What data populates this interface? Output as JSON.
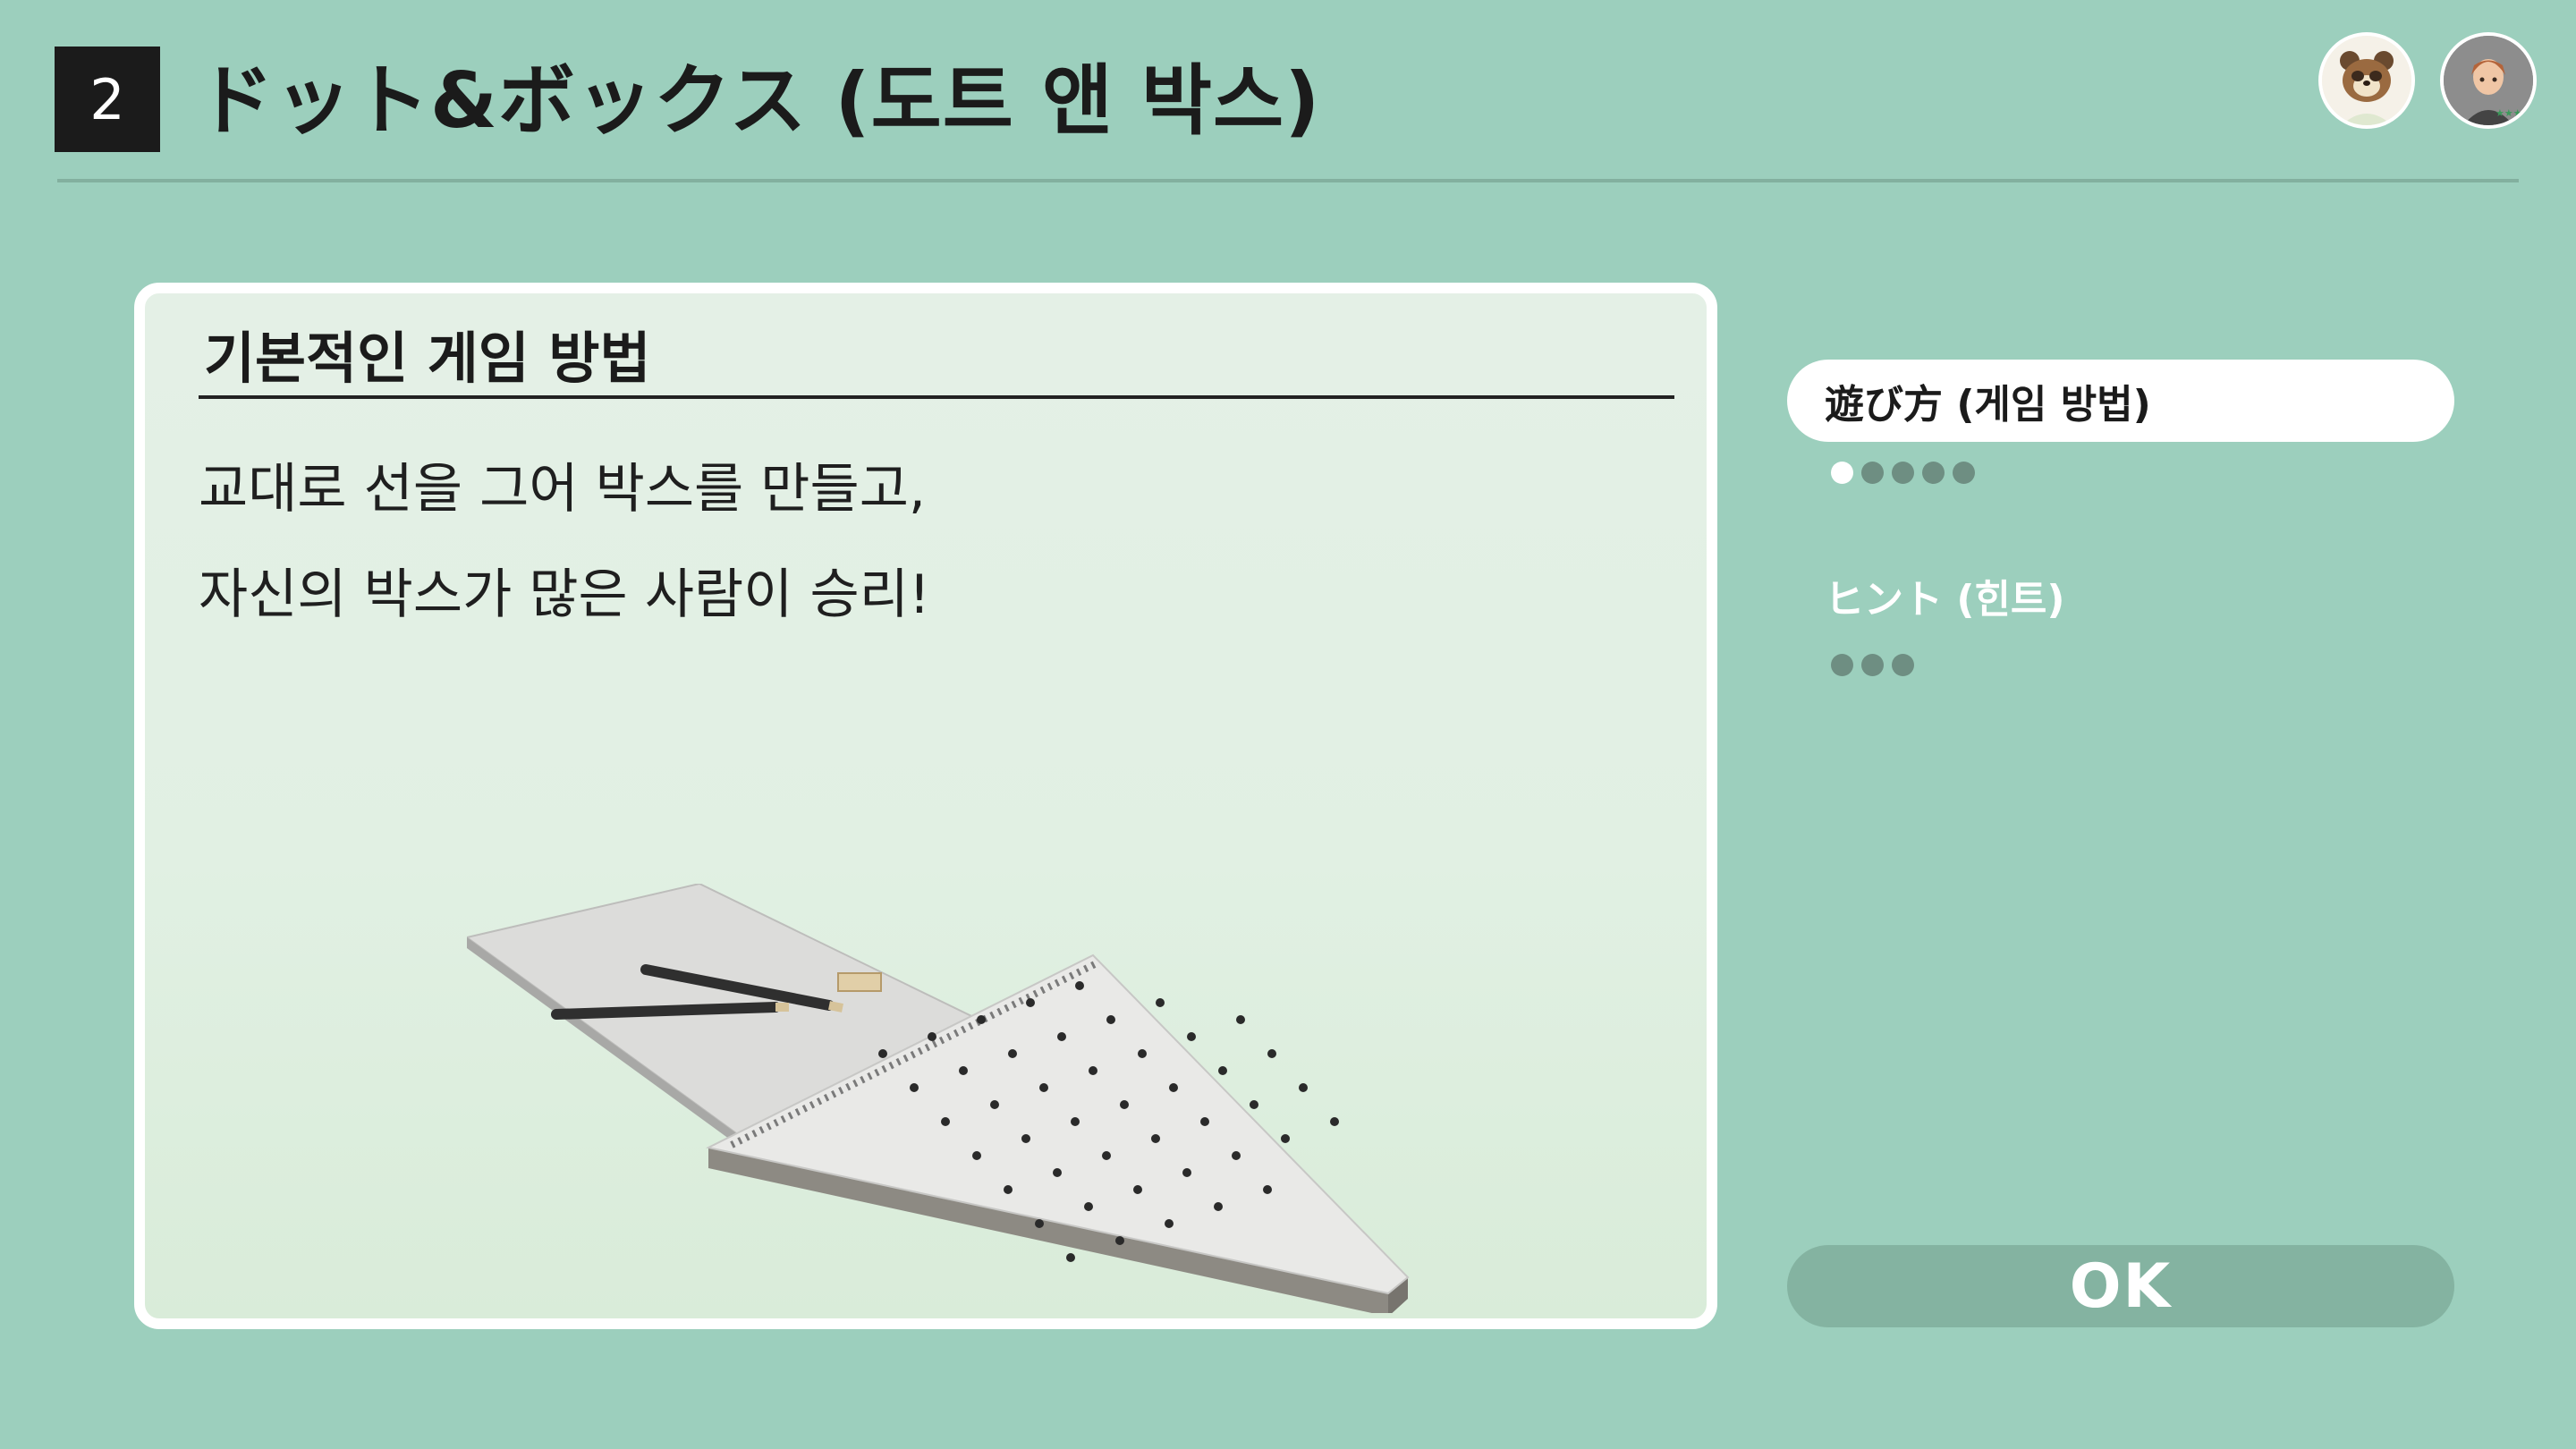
{
  "header": {
    "game_number": "2",
    "title": "ドット&ボックス (도트 앤 박스)",
    "avatars": [
      {
        "name": "tom-nook-avatar-icon"
      },
      {
        "name": "player-avatar-icon"
      }
    ]
  },
  "panel": {
    "heading": "기본적인 게임 방법",
    "lines": [
      "교대로 선을 그어 박스를 만들고,",
      "자신의 박스가 많은 사람이 승리!"
    ],
    "illustration": "notebook-pencils-eraser-illustration"
  },
  "menu": {
    "how_to_play": {
      "label": "遊び方 (게임 방법)",
      "pages": 5,
      "current_page": 1
    },
    "hint": {
      "label": "ヒント (힌트)",
      "pages": 3
    }
  },
  "ok_button": {
    "label": "OK"
  },
  "colors": {
    "background": "#9ccfbd",
    "panel": "#e2f0e4",
    "ok_button": "#84b3a1",
    "dot_inactive": "#6e8e82",
    "dot_active": "#ffffff"
  }
}
